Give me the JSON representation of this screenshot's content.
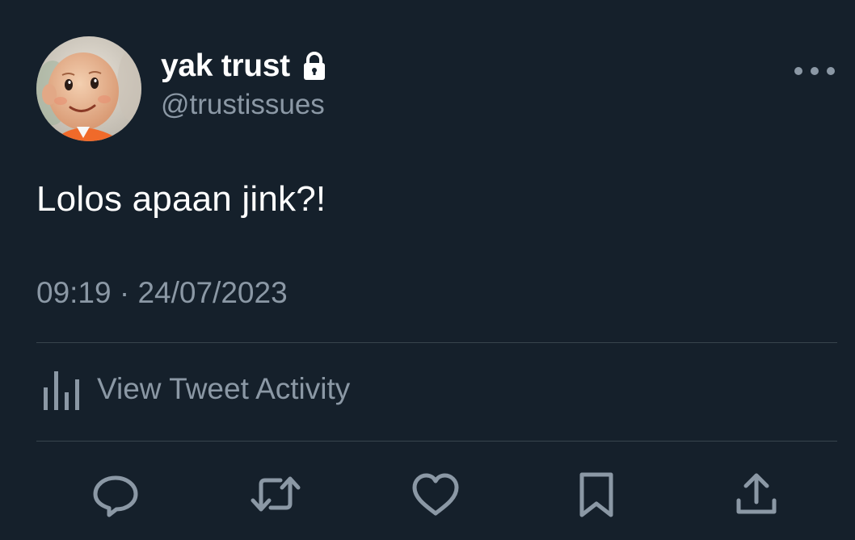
{
  "tweet": {
    "author": {
      "display_name": "yak trust",
      "handle": "@trustissues",
      "protected_icon": "lock-icon",
      "avatar_icon": "avatar-image"
    },
    "more_icon": "more-horizontal-icon",
    "text": "Lolos apaan jink?!",
    "timestamp": "09:19 · 24/07/2023",
    "activity": {
      "icon": "bar-chart-icon",
      "label": "View Tweet Activity"
    },
    "actions": [
      {
        "name": "reply",
        "icon": "reply-icon"
      },
      {
        "name": "retweet",
        "icon": "retweet-icon"
      },
      {
        "name": "like",
        "icon": "heart-icon"
      },
      {
        "name": "bookmark",
        "icon": "bookmark-icon"
      },
      {
        "name": "share",
        "icon": "share-icon"
      }
    ]
  },
  "colors": {
    "background": "#15202b",
    "primary_text": "#ffffff",
    "secondary_text": "#8b98a5",
    "divider": "#38444d"
  }
}
